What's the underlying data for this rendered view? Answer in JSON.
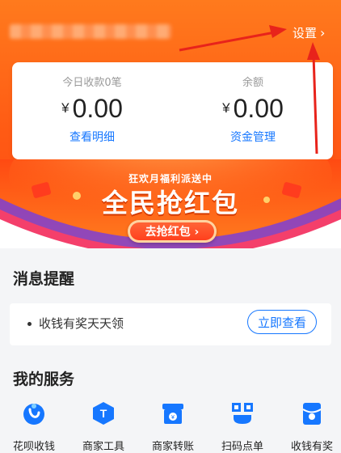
{
  "header": {
    "settings_label": "设置",
    "chevron": "chevron-right-icon"
  },
  "balance_card": {
    "today": {
      "label": "今日收款0笔",
      "currency": "¥",
      "amount": "0.00",
      "link": "查看明细"
    },
    "balance": {
      "label": "余额",
      "currency": "¥",
      "amount": "0.00",
      "link": "资金管理"
    }
  },
  "banner": {
    "subtitle": "狂欢月福利派送中",
    "title": "全民抢红包",
    "button": "去抢红包 ›"
  },
  "messages": {
    "title": "消息提醒",
    "item": "收钱有奖天天领",
    "button": "立即查看"
  },
  "services": {
    "title": "我的服务",
    "items": [
      {
        "label": "花呗收钱",
        "icon": "huabei-icon"
      },
      {
        "label": "商家工具",
        "icon": "merchant-tools-icon"
      },
      {
        "label": "商家转账",
        "icon": "store-transfer-icon"
      },
      {
        "label": "扫码点单",
        "icon": "qr-order-icon"
      },
      {
        "label": "收钱有奖",
        "icon": "reward-icon"
      }
    ]
  },
  "colors": {
    "primary_orange": "#ff5a14",
    "link_blue": "#1677ff",
    "annotation_red": "#e8231b"
  }
}
